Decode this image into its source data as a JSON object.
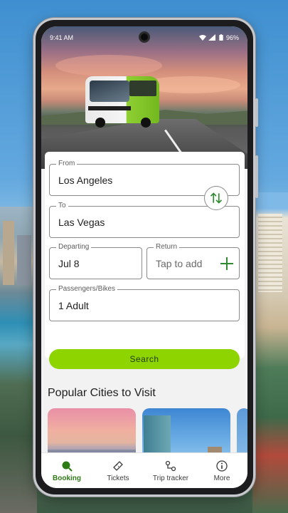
{
  "status_bar": {
    "time": "9:41 AM",
    "battery": "96%"
  },
  "form": {
    "from": {
      "label": "From",
      "value": "Los Angeles"
    },
    "to": {
      "label": "To",
      "value": "Las Vegas"
    },
    "departing": {
      "label": "Departing",
      "value": "Jul 8"
    },
    "return": {
      "label": "Return",
      "placeholder": "Tap to add"
    },
    "passengers": {
      "label": "Passengers/Bikes",
      "value": "1 Adult"
    },
    "search_label": "Search"
  },
  "popular": {
    "title": "Popular Cities to Visit"
  },
  "nav": {
    "items": [
      {
        "label": "Booking",
        "icon": "search-icon",
        "active": true
      },
      {
        "label": "Tickets",
        "icon": "ticket-icon",
        "active": false
      },
      {
        "label": "Trip tracker",
        "icon": "trip-tracker-icon",
        "active": false
      },
      {
        "label": "More",
        "icon": "info-icon",
        "active": false
      }
    ]
  },
  "colors": {
    "accent": "#8ed400",
    "active_nav": "#2e7a16",
    "swap_icon": "#2f8a2f"
  }
}
